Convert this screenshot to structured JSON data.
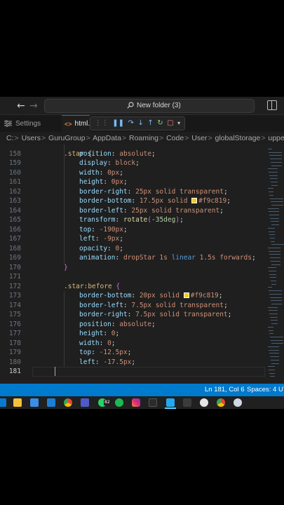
{
  "titlebar": {
    "back_glyph": "←",
    "forward_glyph": "→",
    "search_text": "New folder (3)"
  },
  "tabs": {
    "settings_label": "Settings",
    "html_tab_label": "html.",
    "html_tab_icon": "<>"
  },
  "debug_toolbar": {
    "icons": [
      "drag-handle-icon",
      "pause-icon",
      "step-over-icon",
      "step-into-icon",
      "step-out-icon",
      "restart-icon",
      "stop-icon",
      "chevron-down-icon"
    ]
  },
  "breadcrumb": {
    "parts": [
      "C:",
      "Users",
      "GuruGroup",
      "AppData",
      "Roaming",
      "Code",
      "User",
      "globalStorage",
      "uppernauts.typ"
    ],
    "separator": ">"
  },
  "colors": {
    "swatch": "#f9c819",
    "status_bar": "#007acc",
    "selector": "#d7ba7d",
    "property": "#9cdcfe",
    "value": "#ce9178",
    "number": "#b5cea8"
  },
  "editor": {
    "partial_line": ".star {",
    "lines": [
      {
        "n": "158",
        "prop": "position",
        "val": "absolute"
      },
      {
        "n": "159",
        "prop": "display",
        "val": "block"
      },
      {
        "n": "160",
        "prop": "width",
        "val": "0px"
      },
      {
        "n": "161",
        "prop": "height",
        "val": "0px"
      },
      {
        "n": "162",
        "prop": "border-right",
        "val": "25px solid transparent"
      },
      {
        "n": "163",
        "prop": "border-bottom",
        "val": "17.5px solid",
        "color": "#f9c819"
      },
      {
        "n": "164",
        "prop": "border-left",
        "val": "25px solid transparent"
      },
      {
        "n": "165",
        "prop": "transform",
        "fn": "rotate",
        "arg": "-35deg"
      },
      {
        "n": "166",
        "prop": "top",
        "val": "-190px"
      },
      {
        "n": "167",
        "prop": "left",
        "val": "-9px"
      },
      {
        "n": "168",
        "prop": "opacity",
        "val": "0"
      },
      {
        "n": "169",
        "prop": "animation",
        "val": "dropStar 1s",
        "kw": "linear",
        "tail": "1.5s forwards"
      },
      {
        "n": "170",
        "text": "}"
      },
      {
        "n": "171",
        "text": ""
      },
      {
        "n": "172",
        "text": ".star:before {"
      },
      {
        "n": "173",
        "prop": "border-bottom",
        "val": "20px solid",
        "color": "#f9c819"
      },
      {
        "n": "174",
        "prop": "border-left",
        "val": "7.5px solid transparent"
      },
      {
        "n": "175",
        "prop": "border-right",
        "val": "7.5px solid transparent"
      },
      {
        "n": "176",
        "prop": "position",
        "val": "absolute"
      },
      {
        "n": "177",
        "prop": "height",
        "val": "0"
      },
      {
        "n": "178",
        "prop": "width",
        "val": "0"
      },
      {
        "n": "179",
        "prop": "top",
        "val": "-12.5px"
      },
      {
        "n": "180",
        "prop": "left",
        "val": "-17.5px"
      },
      {
        "n": "181",
        "text": ""
      }
    ]
  },
  "statusbar": {
    "position": "Ln 181, Col 6",
    "spaces": "Spaces: 4",
    "encoding": "UT"
  },
  "taskbar": {
    "badge": "82",
    "apps": [
      "windows-icon",
      "file-explorer-icon",
      "store-icon",
      "mail-icon",
      "chrome-icon",
      "teams-icon",
      "whatsapp-icon",
      "spotify-icon",
      "instagram-icon",
      "vscode-icon",
      "photos-icon",
      "obs-icon",
      "chrome-profile-icon",
      "cloud-icon"
    ]
  }
}
